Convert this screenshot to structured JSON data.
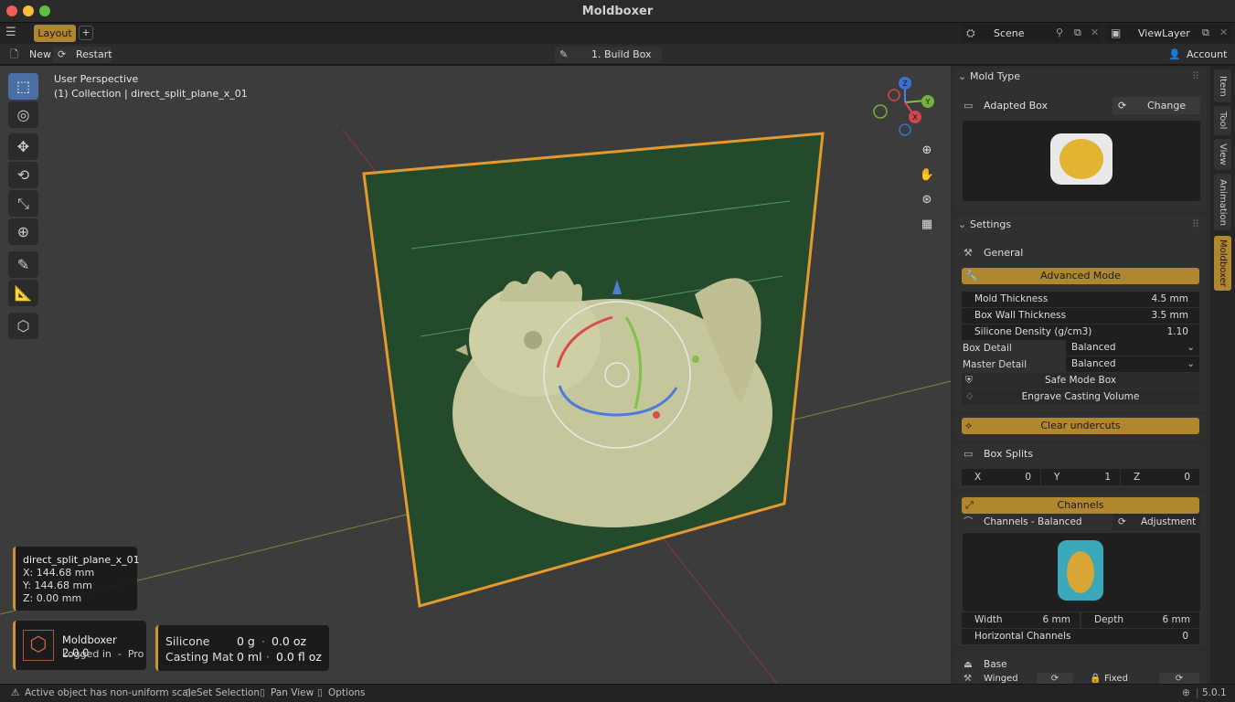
{
  "window": {
    "title": "Moldboxer"
  },
  "tabs": {
    "layout": "Layout",
    "add": "+"
  },
  "header": {
    "scene_label": "Scene",
    "viewlayer_label": "ViewLayer"
  },
  "toolbar": {
    "new_label": "New",
    "restart_label": "Restart",
    "step_label": "1. Build Box",
    "account_label": "Account"
  },
  "viewport": {
    "perspective": "User Perspective",
    "collection": "(1) Collection | direct_split_plane_x_01",
    "gizmo_axes": [
      "Z",
      "Y",
      "X"
    ]
  },
  "object_info": {
    "name": "direct_split_plane_x_01",
    "x": "X: 144.68 mm",
    "y": "Y: 144.68 mm",
    "z": "Z: 0.00 mm"
  },
  "addon_info": {
    "name": "Moldboxer 2.0.0",
    "status": "Logged in  -  Pro"
  },
  "material_info": {
    "silicone_label": "Silicone",
    "silicone_g": "0 g",
    "silicone_oz": "0.0 oz",
    "casting_label": "Casting Mat",
    "casting_ml": "0 ml",
    "casting_floz": "0.0 fl oz",
    "separator": "·"
  },
  "panel": {
    "mold_type": {
      "header": "Mold Type",
      "type_label": "Adapted Box",
      "change_label": "Change"
    },
    "settings": {
      "header": "Settings",
      "general_label": "General",
      "advanced_mode_label": "Advanced Mode",
      "rows": [
        {
          "label": "Mold Thickness",
          "value": "4.5 mm"
        },
        {
          "label": "Box Wall Thickness",
          "value": "3.5 mm"
        },
        {
          "label": "Silicone Density (g/cm3)",
          "value": "1.10"
        }
      ],
      "box_detail_label": "Box Detail",
      "box_detail_value": "Balanced",
      "master_detail_label": "Master Detail",
      "master_detail_value": "Balanced",
      "safe_mode_label": "Safe Mode Box",
      "engrave_label": "Engrave Casting Volume"
    },
    "clear_undercuts_label": "Clear undercuts",
    "box_splits": {
      "header": "Box Splits",
      "x_label": "X",
      "x_value": "0",
      "y_label": "Y",
      "y_value": "1",
      "z_label": "Z",
      "z_value": "0"
    },
    "channels": {
      "header": "Channels",
      "preset_label": "Channels - Balanced",
      "adjustment_label": "Adjustment",
      "width_label": "Width",
      "width_value": "6 mm",
      "depth_label": "Depth",
      "depth_value": "6 mm",
      "horizontal_label": "Horizontal Channels",
      "horizontal_value": "0"
    },
    "base": {
      "header": "Base",
      "winged_label": "Winged",
      "fixed_label": "Fixed"
    }
  },
  "side_tabs": [
    "Item",
    "Tool",
    "View",
    "Animation",
    "Moldboxer"
  ],
  "statusbar": {
    "warning": "Active object has non-uniform scale",
    "set_selection": "Set Selection",
    "pan_view": "Pan View",
    "options": "Options",
    "version": "5.0.1"
  },
  "colors": {
    "accent": "#b0862e",
    "plane": "#244a2c",
    "outline": "#e59a2e",
    "model": "#c9c9a0"
  }
}
